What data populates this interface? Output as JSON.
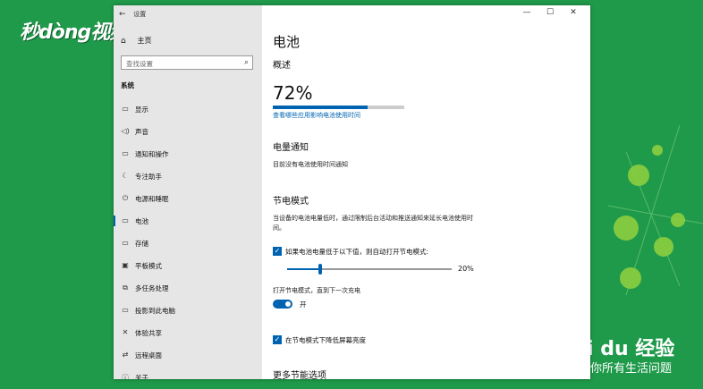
{
  "watermark": {
    "logo_text": "秒dòng视频",
    "baidu_text": "i du 经验",
    "baidu_sub": "你所有生活问题"
  },
  "titlebar": {
    "back_glyph": "←",
    "title": "设置",
    "minimize": "—",
    "maximize": "☐",
    "close": "✕"
  },
  "sidebar": {
    "home_label": "主页",
    "search_placeholder": "查找设置",
    "section_label": "系统",
    "items": [
      {
        "label": "显示",
        "icon": "monitor-icon",
        "glyph": "▭",
        "active": false
      },
      {
        "label": "声音",
        "icon": "speaker-icon",
        "glyph": "◁)",
        "active": false
      },
      {
        "label": "通知和操作",
        "icon": "notification-icon",
        "glyph": "▭",
        "active": false
      },
      {
        "label": "专注助手",
        "icon": "moon-icon",
        "glyph": "☾",
        "active": false
      },
      {
        "label": "电源和睡眠",
        "icon": "power-icon",
        "glyph": "⏻",
        "active": false
      },
      {
        "label": "电池",
        "icon": "battery-icon",
        "glyph": "▭",
        "active": true
      },
      {
        "label": "存储",
        "icon": "storage-icon",
        "glyph": "▭",
        "active": false
      },
      {
        "label": "平板模式",
        "icon": "tablet-icon",
        "glyph": "▣",
        "active": false
      },
      {
        "label": "多任务处理",
        "icon": "multitask-icon",
        "glyph": "⧉",
        "active": false
      },
      {
        "label": "投影到此电脑",
        "icon": "project-icon",
        "glyph": "▭",
        "active": false
      },
      {
        "label": "体验共享",
        "icon": "share-icon",
        "glyph": "✕",
        "active": false
      },
      {
        "label": "远程桌面",
        "icon": "remote-icon",
        "glyph": "⇄",
        "active": false
      },
      {
        "label": "关于",
        "icon": "info-icon",
        "glyph": "ⓘ",
        "active": false
      }
    ]
  },
  "content": {
    "title": "电池",
    "overview_heading": "概述",
    "battery_percent_text": "72%",
    "battery_fraction": 0.72,
    "apps_link": "查看哪些应用影响电池使用时间",
    "notification_heading": "电量通知",
    "notification_text": "目前没有电池使用时间通知",
    "saver_heading": "节电模式",
    "saver_desc": "当设备的电池电量低时，通过限制后台活动和推送通知来延长电池使用时间。",
    "auto_saver_label": "如果电池电量低于以下值，则自动打开节电模式:",
    "auto_saver_checked": true,
    "threshold_text": "20%",
    "threshold_fraction": 0.2,
    "until_charge_label": "打开节电模式，直到下一次充电",
    "toggle_state_label": "开",
    "toggle_on": true,
    "lower_brightness_label": "在节电模式下降低屏幕亮度",
    "lower_brightness_checked": true,
    "more_options_heading": "更多节能选项"
  }
}
